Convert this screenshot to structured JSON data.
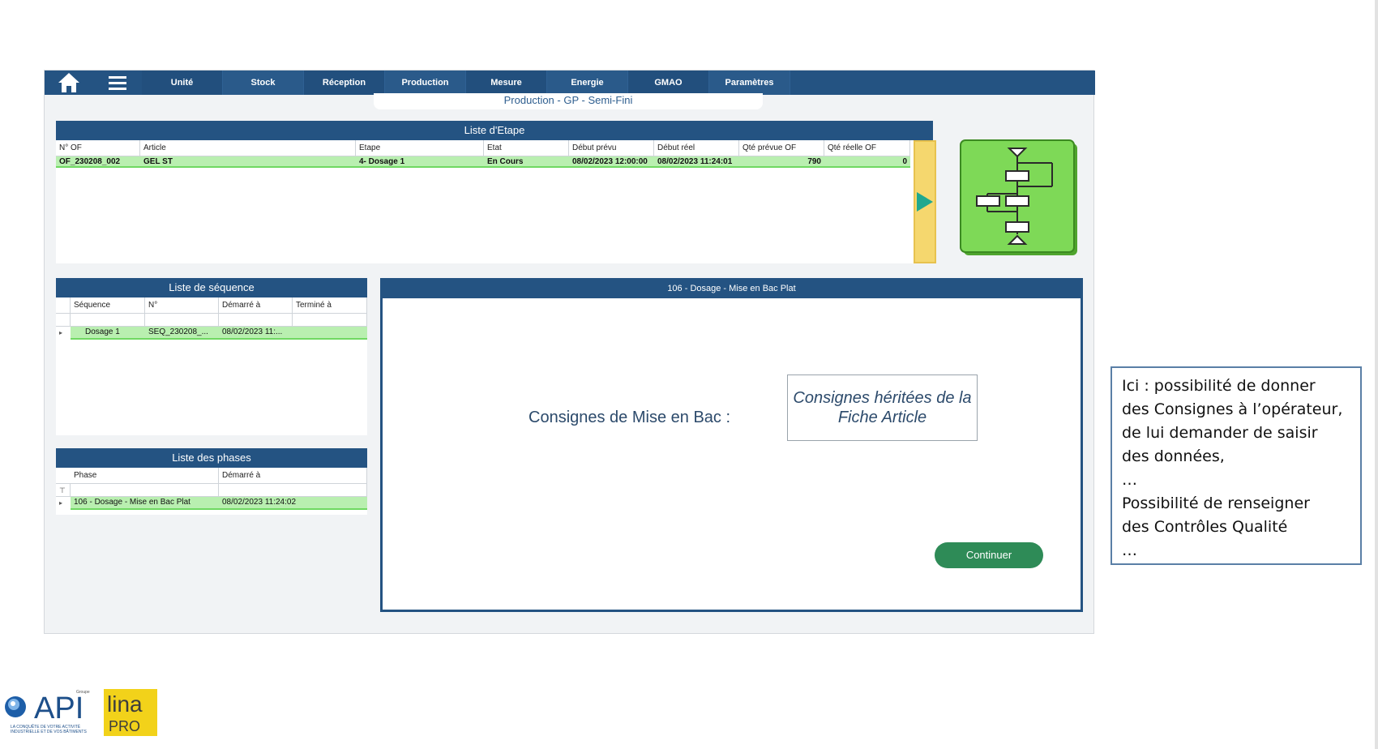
{
  "nav": {
    "tabs": [
      "Unité",
      "Stock",
      "Réception",
      "Production",
      "Mesure",
      "Energie",
      "GMAO",
      "Paramètres"
    ]
  },
  "breadcrumb": "Production - GP - Semi-Fini",
  "etape": {
    "title": "Liste d'Etape",
    "columns": [
      "N° OF",
      "Article",
      "Etape",
      "Etat",
      "Début prévu",
      "Début réel",
      "Qté prévue OF",
      "Qté réelle OF"
    ],
    "row": {
      "of": "OF_230208_002",
      "article": "GEL ST",
      "etape": "4- Dosage 1",
      "etat": "En Cours",
      "debut_prevu": "08/02/2023 12:00:00",
      "debut_reel": "08/02/2023 11:24:01",
      "qte_prevue": "790",
      "qte_reelle": "0"
    }
  },
  "sequence": {
    "title": "Liste de séquence",
    "columns": [
      "Séquence",
      "N°",
      "Démarré à",
      "Terminé à"
    ],
    "row": {
      "sequence": "Dosage 1",
      "numero": "SEQ_230208_...",
      "demarre": "08/02/2023 11:...",
      "termine": ""
    }
  },
  "phases": {
    "title": "Liste des phases",
    "columns": [
      "Phase",
      "Démarré à"
    ],
    "row": {
      "phase": "106 - Dosage - Mise en Bac Plat",
      "demarre": "08/02/2023 11:24:02"
    }
  },
  "step": {
    "title": "106 - Dosage - Mise en Bac Plat",
    "consignes_label": "Consignes de Mise en Bac :",
    "consignes_text": "Consignes héritées de la Fiche Article",
    "continue_label": "Continuer"
  },
  "callout": {
    "lines": [
      "Ici : possibilité de donner",
      "des Consignes à l’opérateur,",
      "de lui demander de saisir",
      "des données,",
      "…",
      "Possibilité de renseigner",
      "des Contrôles Qualité",
      "…"
    ]
  },
  "logos": {
    "api_text": "API",
    "api_group": "Groupe",
    "api_tagline_1": "LA CONQUÊTE DE VOTRE ACTIVITÉ",
    "api_tagline_2": "INDUSTRIELLE ET DE VOS BÂTIMENTS",
    "lina_text": "lina",
    "pro_text": "PRO"
  },
  "colors": {
    "nav_bg": "#245382",
    "row_highlight": "#b9efb0",
    "scroll_bar": "#f5d76e",
    "flow_green": "#7ed957",
    "continue_btn": "#2e8b57"
  }
}
